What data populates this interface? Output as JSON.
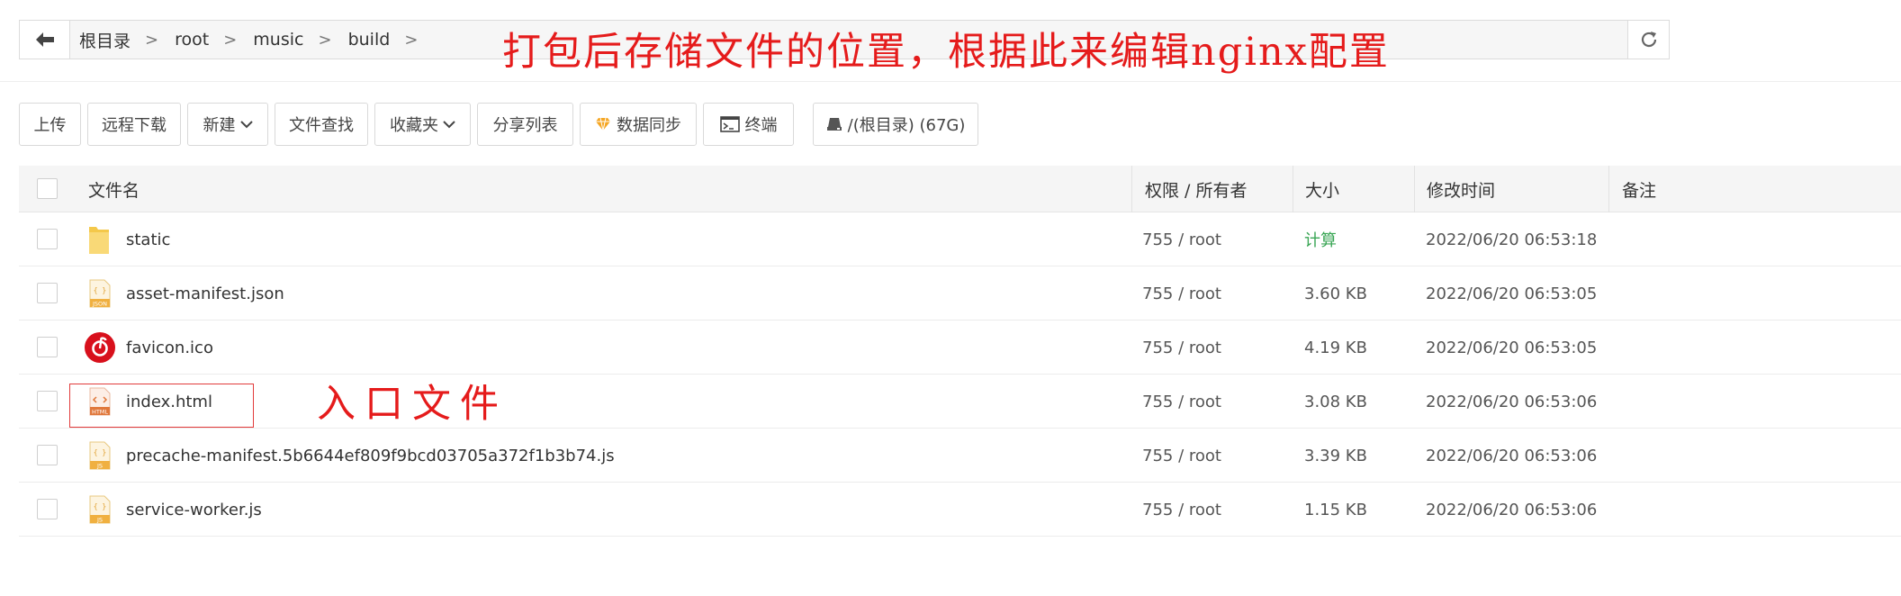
{
  "breadcrumb": {
    "items": [
      "根目录",
      "root",
      "music",
      "build"
    ],
    "separator": ">"
  },
  "annotations": {
    "path_note": "打包后存储文件的位置，根据此来编辑nginx配置",
    "entry_note": "入口文件",
    "color": "#e51b1b"
  },
  "toolbar": {
    "upload": "上传",
    "remote_download": "远程下载",
    "new": "新建",
    "file_search": "文件查找",
    "favorites": "收藏夹",
    "share_list": "分享列表",
    "data_sync": "数据同步",
    "terminal": "终端",
    "disk": "/(根目录) (67G)"
  },
  "table": {
    "headers": {
      "name": "文件名",
      "perm": "权限 / 所有者",
      "size": "大小",
      "mtime": "修改时间",
      "note": "备注"
    },
    "rows": [
      {
        "name": "static",
        "icon": "folder-icon",
        "perm": "755 / root",
        "size": "计算",
        "mtime": "2022/06/20 06:53:18"
      },
      {
        "name": "asset-manifest.json",
        "icon": "json-file-icon",
        "perm": "755 / root",
        "size": "3.60 KB",
        "mtime": "2022/06/20 06:53:05"
      },
      {
        "name": "favicon.ico",
        "icon": "netease-music-icon",
        "perm": "755 / root",
        "size": "4.19 KB",
        "mtime": "2022/06/20 06:53:05"
      },
      {
        "name": "index.html",
        "icon": "html-file-icon",
        "perm": "755 / root",
        "size": "3.08 KB",
        "mtime": "2022/06/20 06:53:06"
      },
      {
        "name": "precache-manifest.5b6644ef809f9bcd03705a372f1b3b74.js",
        "icon": "js-file-icon",
        "perm": "755 / root",
        "size": "3.39 KB",
        "mtime": "2022/06/20 06:53:06"
      },
      {
        "name": "service-worker.js",
        "icon": "js-file-icon",
        "perm": "755 / root",
        "size": "1.15 KB",
        "mtime": "2022/06/20 06:53:06"
      }
    ]
  },
  "file_badges": {
    "json": "JSON",
    "html": "HTML",
    "js": "JS"
  },
  "colors": {
    "accent_green": "#3aa655",
    "folder": "#f4c84a",
    "annotation_red": "#e51b1b"
  }
}
